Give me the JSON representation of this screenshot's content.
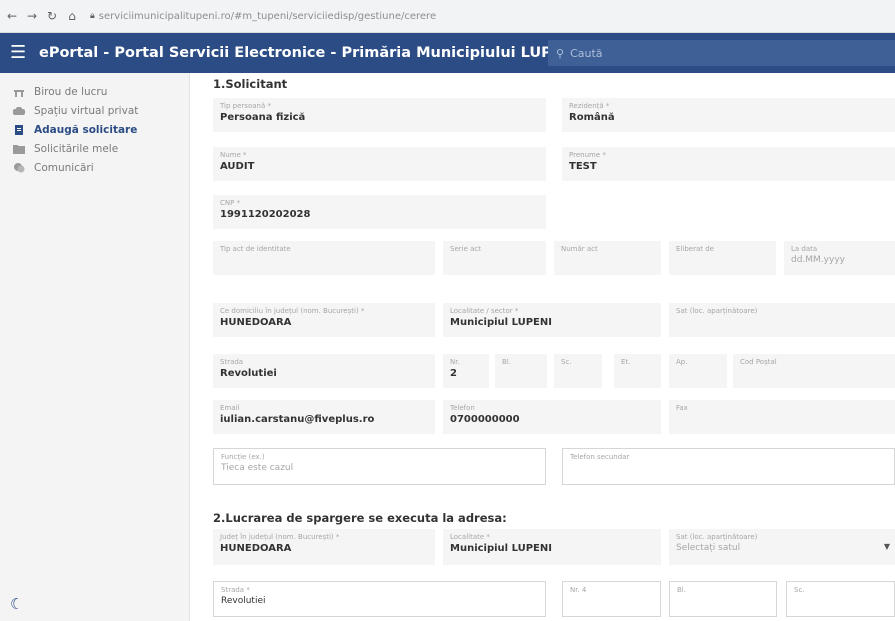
{
  "browser": {
    "url": "serviciimunicipalitupeni.ro/#m_tupeni/serviciiedisp/gestiune/cerere"
  },
  "header": {
    "title": "ePortal - Portal Servicii Electronice - Primăria Municipiului LUPENI",
    "search_placeholder": "Caută"
  },
  "sidebar": {
    "items": [
      {
        "label": "Birou de lucru"
      },
      {
        "label": "Spațiu virtual privat"
      },
      {
        "label": "Adaugă solicitare"
      },
      {
        "label": "Solicitările mele"
      },
      {
        "label": "Comunicări"
      }
    ]
  },
  "form": {
    "section1_title": "1.Solicitant",
    "section2_title": "2.Lucrarea de spargere se executa la adresa:",
    "tip_persoana": {
      "label": "Tip persoană *",
      "value": "Persoana fizică"
    },
    "rezidenta": {
      "label": "Rezidență *",
      "value": "Română"
    },
    "nume": {
      "label": "Nume *",
      "value": "AUDIT"
    },
    "prenume": {
      "label": "Prenume *",
      "value": "TEST"
    },
    "cnp": {
      "label": "CNP *",
      "value": "1991120202028"
    },
    "tip_act": {
      "label": "Tip act de identitate"
    },
    "serie_act": {
      "label": "Serie act"
    },
    "numar_act": {
      "label": "Număr act"
    },
    "eliberat_de": {
      "label": "Eliberat de"
    },
    "la_data": {
      "label": "La data",
      "placeholder": "dd.MM.yyyy"
    },
    "judet": {
      "label": "Ce domiciliu în județul (nom. București) *",
      "value": "HUNEDOARA"
    },
    "localitate": {
      "label": "Localitate / sector *",
      "value": "Municipiul LUPENI"
    },
    "sat": {
      "label": "Sat (loc. aparținătoare)"
    },
    "strada": {
      "label": "Strada",
      "value": "Revolutiei"
    },
    "nr": {
      "label": "Nr.",
      "value": "2"
    },
    "bl": {
      "label": "Bl."
    },
    "sc": {
      "label": "Sc."
    },
    "et": {
      "label": "Et."
    },
    "ap": {
      "label": "Ap."
    },
    "cod_postal": {
      "label": "Cod Poștal"
    },
    "email": {
      "label": "Email",
      "value": "iulian.carstanu@fiveplus.ro"
    },
    "telefon": {
      "label": "Telefon",
      "value": "0700000000"
    },
    "fax": {
      "label": "Fax"
    },
    "functie": {
      "label": "Funcție (ex.)",
      "placeholder": "Tieca este cazul"
    },
    "telefon_secundar": {
      "label": "Telefon secundar"
    },
    "judet2": {
      "label": "Județ în județul (nom. București) *",
      "value": "HUNEDOARA"
    },
    "localitate2": {
      "label": "Localitate *",
      "value": "Municipiul LUPENI"
    },
    "sat2": {
      "label": "Sat (loc. aparținătoare)",
      "placeholder": "Selectați satul"
    },
    "strada2": {
      "label": "Strada *",
      "value": "Revolutiei"
    },
    "nr2": {
      "label": "Nr. 4"
    },
    "bl2": {
      "label": "Bl."
    },
    "sc2": {
      "label": "Sc."
    }
  }
}
